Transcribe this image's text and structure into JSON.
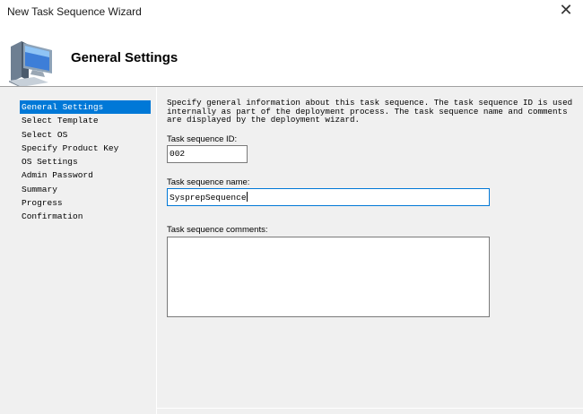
{
  "window": {
    "title": "New Task Sequence Wizard",
    "close_glyph": "✕"
  },
  "header": {
    "title": "General Settings",
    "icon": "computer-icon"
  },
  "nav": {
    "items": [
      {
        "label": "General Settings",
        "selected": true
      },
      {
        "label": "Select Template"
      },
      {
        "label": "Select OS"
      },
      {
        "label": "Specify Product Key"
      },
      {
        "label": "OS Settings"
      },
      {
        "label": "Admin Password"
      },
      {
        "label": "Summary"
      },
      {
        "label": "Progress"
      },
      {
        "label": "Confirmation"
      }
    ]
  },
  "form": {
    "description": "Specify general information about this task sequence.  The task sequence ID is used internally as part of the deployment process.  The task sequence name and comments are displayed by the deployment wizard.",
    "id_label": "Task sequence ID:",
    "id_value": "002",
    "name_label": "Task sequence name:",
    "name_value": "SysprepSequence",
    "comments_label": "Task sequence comments:",
    "comments_value": ""
  },
  "colors": {
    "selection": "#0078d7",
    "pane_background": "#f0f0f0",
    "focus_border": "#0078d7"
  }
}
